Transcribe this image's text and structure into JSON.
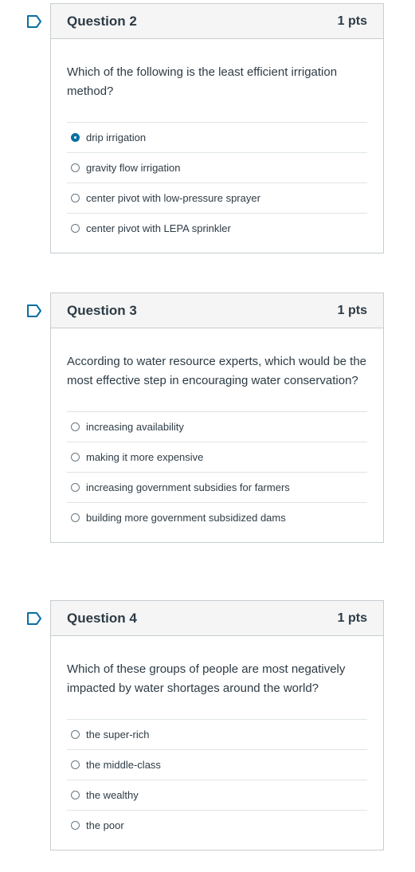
{
  "colors": {
    "accent": "#0770a3",
    "border": "#c7cdd1",
    "header_bg": "#f5f5f5",
    "text": "#2d3b45"
  },
  "icons": {
    "flag": "flag-bookmark-icon",
    "radio": "radio-button-icon"
  },
  "questions": [
    {
      "title": "Question 2",
      "points": "1 pts",
      "text": "Which of the following is the least efficient irrigation method?",
      "answers": [
        {
          "label": "drip irrigation",
          "selected": true
        },
        {
          "label": "gravity flow irrigation",
          "selected": false
        },
        {
          "label": "center pivot with low-pressure sprayer",
          "selected": false
        },
        {
          "label": "center pivot with LEPA sprinkler",
          "selected": false
        }
      ]
    },
    {
      "title": "Question 3",
      "points": "1 pts",
      "text": "According to water resource experts, which would be the most effective step in encouraging water conservation?",
      "answers": [
        {
          "label": "increasing availability",
          "selected": false
        },
        {
          "label": "making it more expensive",
          "selected": false
        },
        {
          "label": "increasing government subsidies for farmers",
          "selected": false
        },
        {
          "label": "building more government subsidized dams",
          "selected": false
        }
      ]
    },
    {
      "title": "Question 4",
      "points": "1 pts",
      "text": "Which of these groups of people are most negatively impacted by water shortages around the world?",
      "answers": [
        {
          "label": "the super-rich",
          "selected": false
        },
        {
          "label": "the middle-class",
          "selected": false
        },
        {
          "label": "the wealthy",
          "selected": false
        },
        {
          "label": "the poor",
          "selected": false
        }
      ]
    }
  ]
}
